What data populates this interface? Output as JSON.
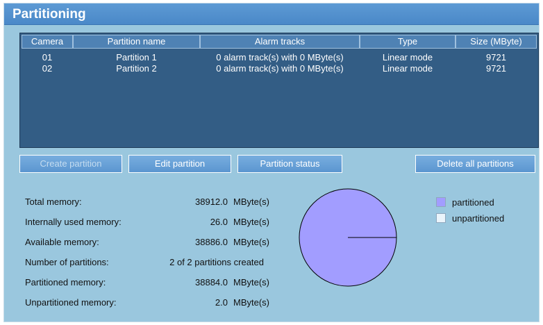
{
  "header": {
    "title": "Partitioning"
  },
  "table": {
    "columns": [
      "Camera",
      "Partition name",
      "Alarm tracks",
      "Type",
      "Size (MByte)"
    ],
    "rows": [
      [
        "01",
        "Partition 1",
        "0 alarm track(s) with 0 MByte(s)",
        "Linear mode",
        "9721"
      ],
      [
        "02",
        "Partition 2",
        "0 alarm track(s) with 0 MByte(s)",
        "Linear mode",
        "9721"
      ]
    ]
  },
  "buttons": {
    "create": "Create partition",
    "edit": "Edit partition",
    "status": "Partition status",
    "delete_all": "Delete all partitions"
  },
  "stats": [
    {
      "label": "Total memory:",
      "value": "38912.0",
      "unit": "MByte(s)"
    },
    {
      "label": "Internally used memory:",
      "value": "26.0",
      "unit": "MByte(s)"
    },
    {
      "label": "Available memory:",
      "value": "38886.0",
      "unit": "MByte(s)"
    },
    {
      "label": "Number of partitions:",
      "value": "2 of 2 partitions created",
      "unit": ""
    },
    {
      "label": "Partitioned memory:",
      "value": "38884.0",
      "unit": "MByte(s)"
    },
    {
      "label": "Unpartitioned memory:",
      "value": "2.0",
      "unit": "MByte(s)"
    }
  ],
  "legend": [
    {
      "label": "partitioned",
      "color": "#a29dff"
    },
    {
      "label": "unpartitioned",
      "color": "#eaf4fb"
    }
  ],
  "chart_data": {
    "type": "pie",
    "categories": [
      "partitioned",
      "unpartitioned"
    ],
    "values": [
      38884.0,
      2.0
    ],
    "colors": [
      "#a29dff",
      "#eaf4fb"
    ],
    "legend_position": "right"
  }
}
